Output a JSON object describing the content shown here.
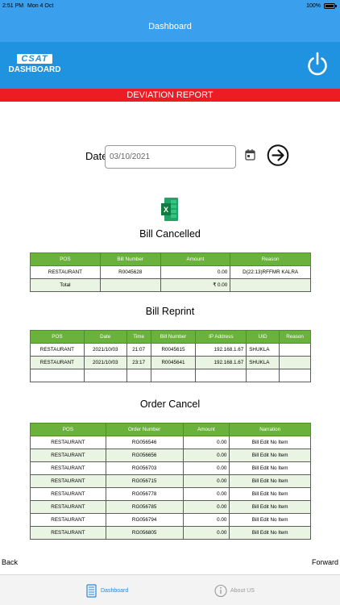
{
  "status_bar": {
    "time": "2:51 PM",
    "date": "Mon 4 Oct",
    "battery": "100%"
  },
  "nav": {
    "title": "Dashboard"
  },
  "header": {
    "logo_top": "CSAT",
    "logo_bottom": "DASHBOARD",
    "power_icon": "power-icon"
  },
  "banner": {
    "title": "DEVIATION REPORT"
  },
  "filter": {
    "date_label": "Date",
    "date_value": "03/10/2021",
    "calendar_icon": "calendar-icon",
    "go_icon": "arrow-right-circle-icon"
  },
  "excel": {
    "icon": "excel-icon"
  },
  "bill_cancelled": {
    "title": "Bill Cancelled",
    "columns": [
      "POS",
      "Bill Number",
      "Amount",
      "Reason"
    ],
    "rows": [
      [
        "RESTAURANT",
        "R0045628",
        "0.00",
        "D(22:13)RFFMR KALRA"
      ]
    ],
    "total": {
      "label": "Total",
      "amount": "₹ 0.00"
    }
  },
  "bill_reprint": {
    "title": "Bill Reprint",
    "columns": [
      "POS",
      "Date",
      "Time",
      "Bill Number",
      "IP Address",
      "UID",
      "Reason"
    ],
    "rows": [
      [
        "RESTAURANT",
        "2021/10/03",
        "21:07",
        "R0045615",
        "192.168.1.67",
        "SHUKLA",
        ""
      ],
      [
        "RESTAURANT",
        "2021/10/03",
        "23:17",
        "R0045641",
        "192.168.1.67",
        "SHUKLA",
        ""
      ]
    ]
  },
  "order_cancel": {
    "title": "Order Cancel",
    "columns": [
      "POS",
      "Order Number",
      "Amount",
      "Narration"
    ],
    "rows": [
      [
        "RESTAURANT",
        "RG056546",
        "0.00",
        "Bill Edit No Item"
      ],
      [
        "RESTAURANT",
        "RG056656",
        "0.00",
        "Bill Edit No Item"
      ],
      [
        "RESTAURANT",
        "RG056703",
        "0.00",
        "Bill Edit No Item"
      ],
      [
        "RESTAURANT",
        "RG056715",
        "0.00",
        "Bill Edit No Item"
      ],
      [
        "RESTAURANT",
        "RG056778",
        "0.00",
        "Bill Edit No Item"
      ],
      [
        "RESTAURANT",
        "RG056785",
        "0.00",
        "Bill Edit No Item"
      ],
      [
        "RESTAURANT",
        "RG056794",
        "0.00",
        "Bill Edit No Item"
      ],
      [
        "RESTAURANT",
        "RG056805",
        "0.00",
        "Bill Edit No Item"
      ]
    ]
  },
  "browser_nav": {
    "back": "Back",
    "forward": "Forward"
  },
  "tabs": [
    {
      "label": "Dashboard",
      "icon": "dashboard-icon",
      "active": true
    },
    {
      "label": "About US",
      "icon": "info-icon",
      "active": false
    }
  ],
  "colors": {
    "primary_blue": "#1f93e0",
    "banner_red": "#ec1c24",
    "table_header_green": "#6ab23b"
  }
}
